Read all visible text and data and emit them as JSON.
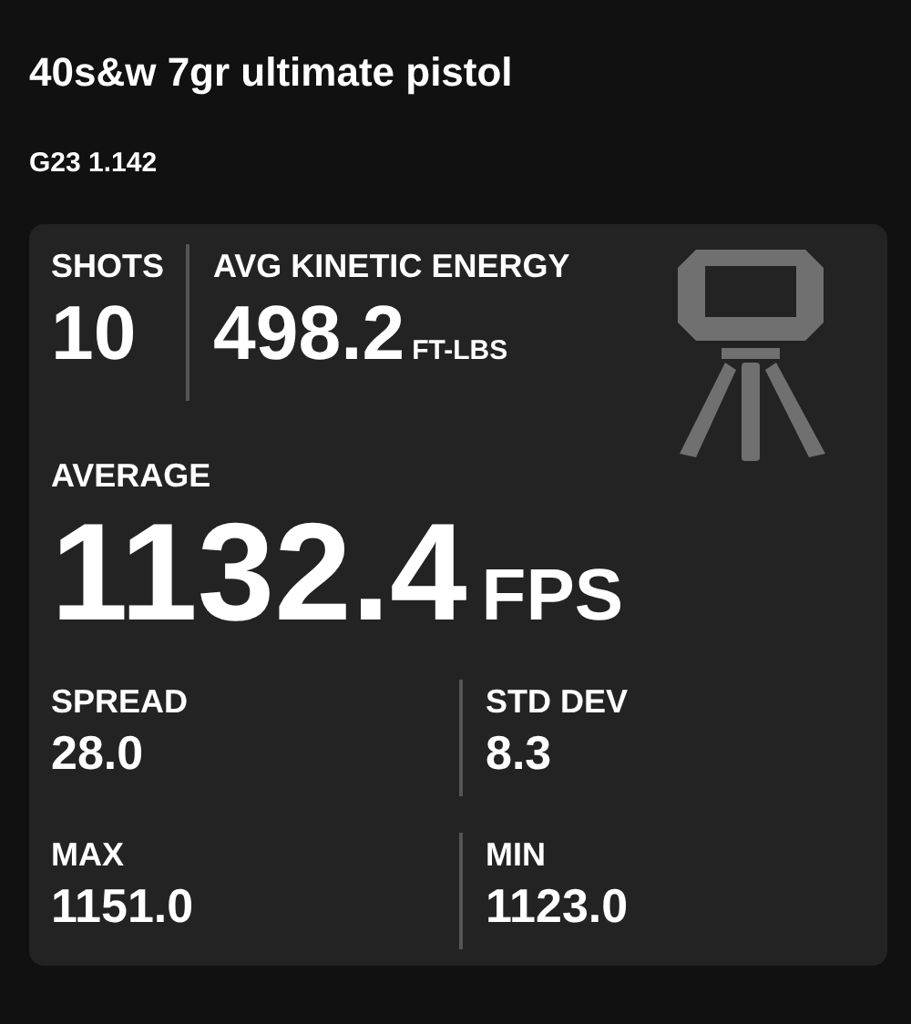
{
  "title": "40s&w 7gr ultimate pistol",
  "subtitle": "G23 1.142",
  "shots": {
    "label": "SHOTS",
    "value": "10"
  },
  "energy": {
    "label": "AVG KINETIC ENERGY",
    "value": "498.2",
    "unit": "FT-LBS"
  },
  "average": {
    "label": "AVERAGE",
    "value": "1132.4",
    "unit": "FPS"
  },
  "metrics": [
    {
      "label": "SPREAD",
      "value": "28.0"
    },
    {
      "label": "STD DEV",
      "value": "8.3"
    },
    {
      "label": "MAX",
      "value": "1151.0"
    },
    {
      "label": "MIN",
      "value": "1123.0"
    }
  ]
}
